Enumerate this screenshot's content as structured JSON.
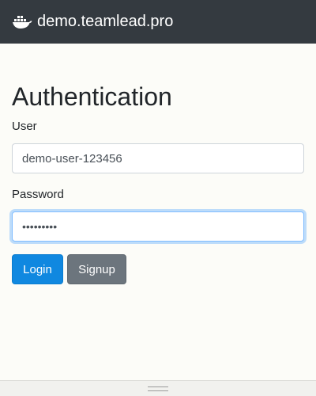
{
  "navbar": {
    "brand": "demo.teamlead.pro",
    "icon": "docker-whale-icon",
    "background": "#343a40"
  },
  "main": {
    "title": "Authentication",
    "user": {
      "label": "User",
      "value": "demo-user-123456"
    },
    "password": {
      "label": "Password",
      "value": "•••••••••"
    },
    "buttons": {
      "login": "Login",
      "signup": "Signup"
    }
  },
  "colors": {
    "primary": "#1088e0",
    "secondary": "#6c757d",
    "focus_border": "#80bdff"
  }
}
